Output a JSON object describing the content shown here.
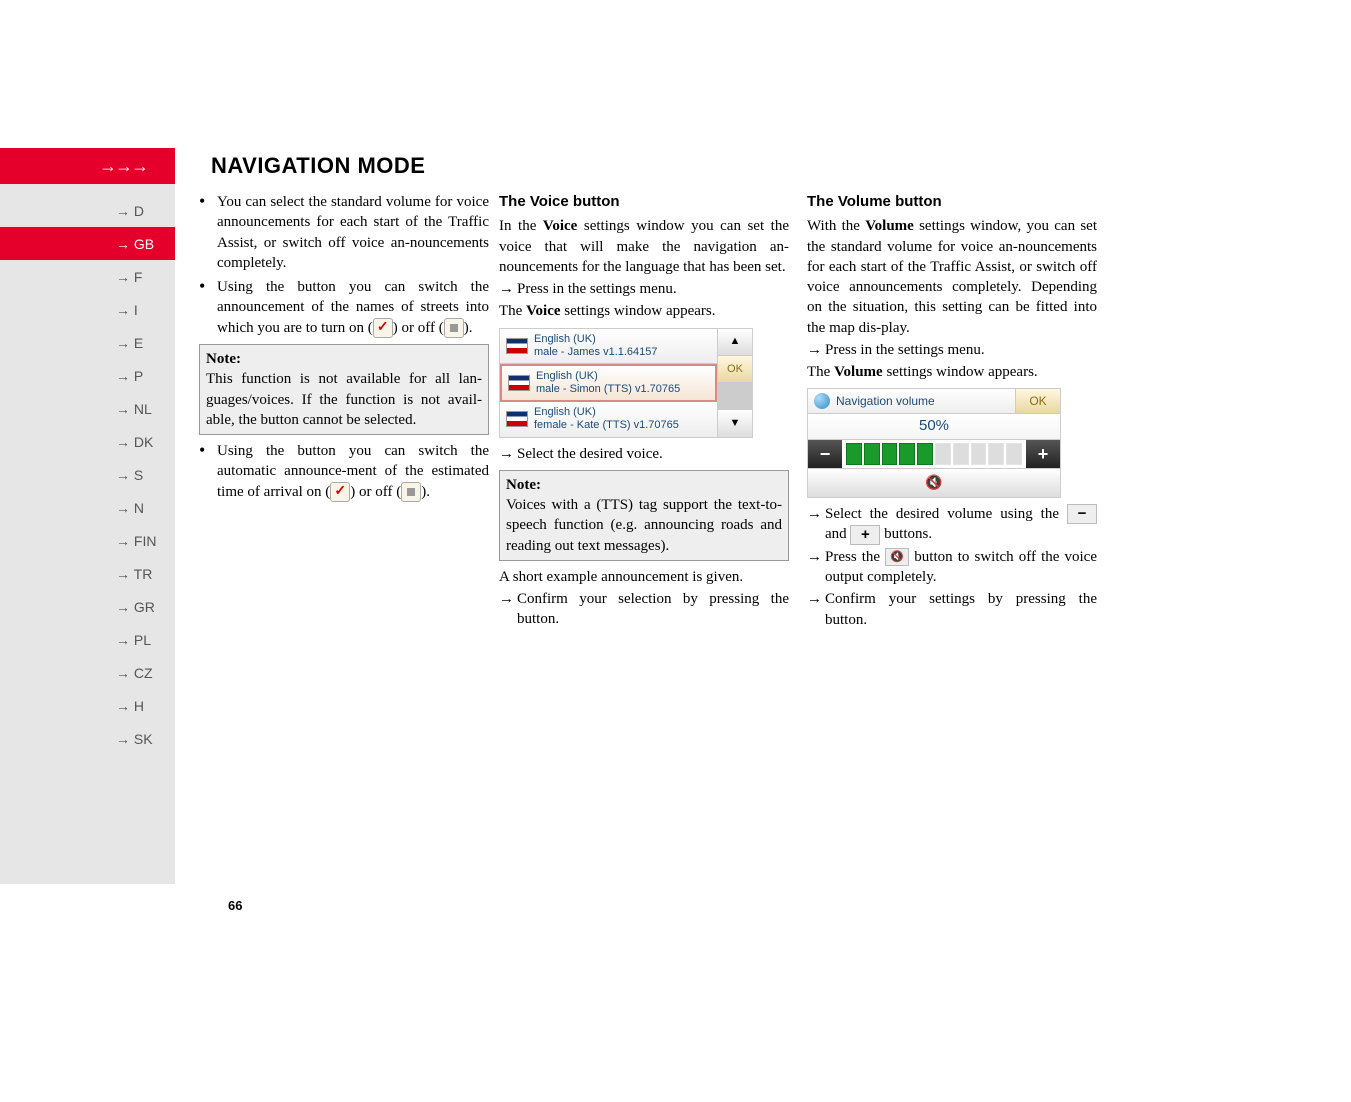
{
  "header": {
    "arrows": "→→→",
    "title": "NAVIGATION MODE"
  },
  "sidebar": {
    "items": [
      {
        "label": "→ D"
      },
      {
        "label": "→ GB",
        "active": true
      },
      {
        "label": "→ F"
      },
      {
        "label": "→ I"
      },
      {
        "label": "→ E"
      },
      {
        "label": "→ P"
      },
      {
        "label": "→ NL"
      },
      {
        "label": "→ DK"
      },
      {
        "label": "→ S"
      },
      {
        "label": "→ N"
      },
      {
        "label": "→ FIN"
      },
      {
        "label": "→ TR"
      },
      {
        "label": "→ GR"
      },
      {
        "label": "→ PL"
      },
      {
        "label": "→ CZ"
      },
      {
        "label": "→ H"
      },
      {
        "label": "→ SK"
      }
    ]
  },
  "col1": {
    "b1": "You can select the standard volume for voice announcements for each start of the Traffic Assist, or switch off voice an-nouncements completely.",
    "b2a": "Using the ",
    "b2b": " button you can switch the announcement of the names of streets into which you are to turn on (",
    "b2c": ") or off (",
    "b2d": ").",
    "noteLabel": "Note:",
    "noteText": "This function is not available for all lan-guages/voices. If the function is not avail-able, the button cannot be selected.",
    "b3a": "Using the ",
    "b3b": " button you can switch the automatic announce-ment of the estimated time of arrival on (",
    "b3c": ") or off (",
    "b3d": ")."
  },
  "col2": {
    "heading": "The Voice button",
    "p1a": "In the ",
    "p1bold": "Voice",
    "p1b": " settings window you can set the voice that will make the navigation an-nouncements for the language that has been set.",
    "press1a": "Press ",
    "press1b": " in the settings menu.",
    "p2a": "The ",
    "p2bold": "Voice",
    "p2b": " settings window appears.",
    "voices": [
      {
        "line1": "English (UK)",
        "line2": "male - James v1.1.64157"
      },
      {
        "line1": "English (UK)",
        "line2": "male - Simon (TTS) v1.70765",
        "selected": true
      },
      {
        "line1": "English (UK)",
        "line2": "female - Kate (TTS) v1.70765"
      }
    ],
    "okLabel": "OK",
    "upLabel": "▲",
    "downLabel": "▼",
    "select": "Select the desired voice.",
    "note2Label": "Note:",
    "note2Text": "Voices with a (TTS) tag support the text-to-speech function (e.g. announcing roads and reading out text messages).",
    "p3": "A short example announcement is given.",
    "confirm1": "Confirm your selection by pressing the ",
    "confirm2": " button."
  },
  "col3": {
    "heading": "The Volume button",
    "p1a": "With the ",
    "p1bold": "Volume",
    "p1b": " settings window, you can set the standard volume for voice an-nouncements for each start of the Traffic Assist, or switch off voice announcements completely. Depending on the situation, this setting can be fitted into the map dis-play.",
    "press1a": "Press ",
    "press1b": " in the settings menu.",
    "p2a": "The ",
    "p2bold": "Volume",
    "p2b": " settings window appears.",
    "volTitle": "Navigation volume",
    "volOk": "OK",
    "volPct": "50%",
    "sel1": "Select the desired volume using the ",
    "sel2": " and ",
    "sel3": " buttons.",
    "mute1": "Press the ",
    "mute2": " button to switch off the voice output completely.",
    "confirm1": "Confirm your settings by pressing the ",
    "confirm2": " button."
  },
  "pageNumber": "66"
}
